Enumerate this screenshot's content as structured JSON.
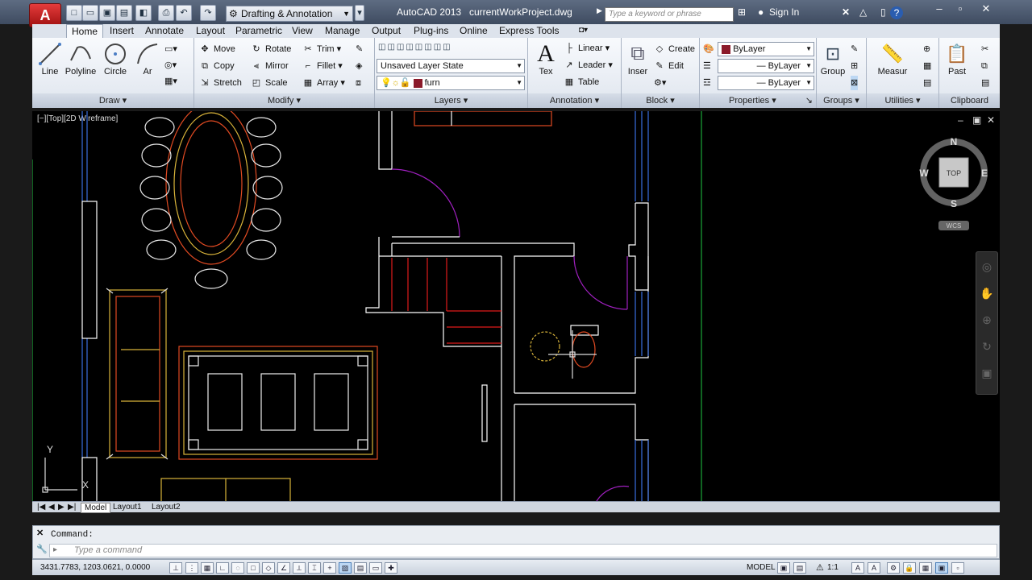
{
  "titlebar": {
    "app_logo": "A",
    "workspace": "Drafting & Annotation",
    "app_name": "AutoCAD 2013",
    "file_name": "currentWorkProject.dwg",
    "search_placeholder": "Type a keyword or phrase",
    "sign_in": "Sign In",
    "help": "?"
  },
  "tabs": [
    "Home",
    "Insert",
    "Annotate",
    "Layout",
    "Parametric",
    "View",
    "Manage",
    "Output",
    "Plug-ins",
    "Online",
    "Express Tools"
  ],
  "ribbon": {
    "draw": {
      "title": "Draw",
      "line": "Line",
      "polyline": "Polyline",
      "circle": "Circle",
      "arc": "Ar"
    },
    "modify": {
      "title": "Modify",
      "move": "Move",
      "rotate": "Rotate",
      "trim": "Trim",
      "copy": "Copy",
      "mirror": "Mirror",
      "fillet": "Fillet",
      "stretch": "Stretch",
      "scale": "Scale",
      "array": "Array"
    },
    "layers": {
      "title": "Layers",
      "layer_state": "Unsaved Layer State",
      "current_layer": "furn"
    },
    "annotation": {
      "title": "Annotation",
      "text": "Tex",
      "linear": "Linear",
      "leader": "Leader",
      "table": "Table"
    },
    "block": {
      "title": "Block",
      "insert": "Inser",
      "create": "Create",
      "edit": "Edit"
    },
    "properties": {
      "title": "Properties",
      "color": "ByLayer",
      "linetype": "ByLayer",
      "lineweight": "ByLayer"
    },
    "groups": {
      "title": "Groups",
      "group": "Group"
    },
    "utilities": {
      "title": "Utilities",
      "measure": "Measur"
    },
    "clipboard": {
      "title": "Clipboard",
      "paste": "Past"
    }
  },
  "viewport": {
    "label": "[−][Top][2D Wireframe]",
    "viewcube": {
      "n": "N",
      "s": "S",
      "e": "E",
      "w": "W",
      "top": "TOP",
      "wcs": "WCS"
    },
    "ucs": {
      "x": "X",
      "y": "Y"
    }
  },
  "layout_tabs": [
    "Model",
    "Layout1",
    "Layout2"
  ],
  "command": {
    "history": "Command:",
    "placeholder": "Type a command"
  },
  "status": {
    "coords": "3431.7783, 1203.0621, 0.0000",
    "model": "MODEL",
    "scale": "1:1"
  },
  "colors": {
    "layer_swatch": "#8b1a2a",
    "bylayer_swatch": "#8b1a2a",
    "furniture": "#e04a22",
    "walls": "#ffffff",
    "doors": "#a020c0",
    "windows": "#3a6fe0"
  }
}
